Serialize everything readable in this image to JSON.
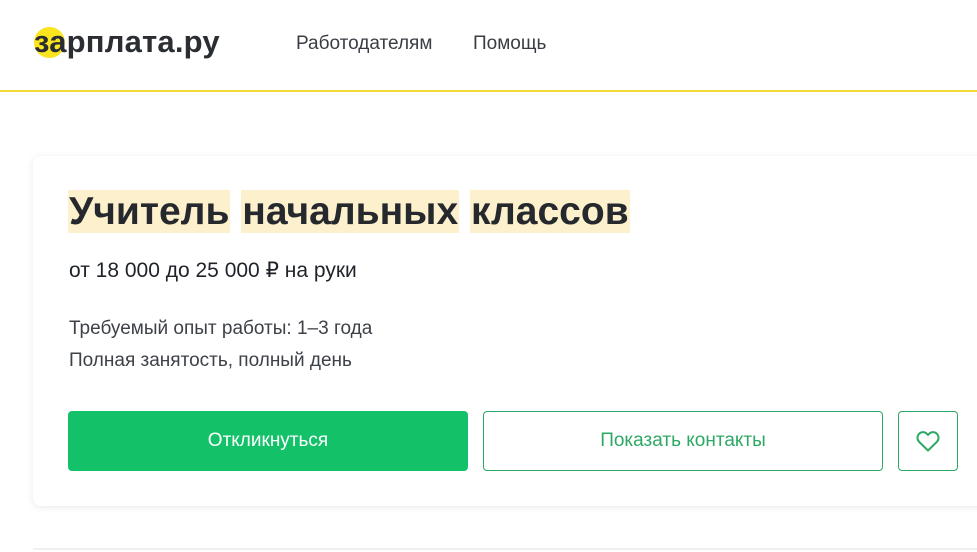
{
  "header": {
    "logo_text": "зарплата.ру",
    "nav": [
      {
        "label": "Работодателям"
      },
      {
        "label": "Помощь"
      }
    ]
  },
  "vacancy": {
    "title_words": [
      "Учитель",
      "начальных",
      "классов"
    ],
    "salary": "от 18 000 до 25 000 ₽ на руки",
    "experience": "Требуемый опыт работы: 1–3 года",
    "employment": "Полная занятость, полный день"
  },
  "actions": {
    "apply_label": "Откликнуться",
    "contacts_label": "Показать контакты",
    "favorite_icon": "heart-icon"
  },
  "colors": {
    "brand_yellow": "#fbe51e",
    "accent_green": "#13c268",
    "highlight": "#fdf0cc"
  }
}
